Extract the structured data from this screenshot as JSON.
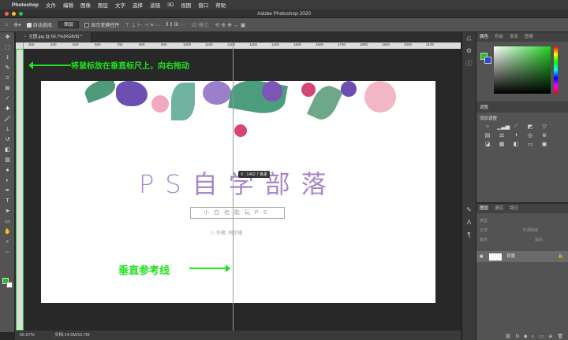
{
  "menubar": {
    "app": "Photoshop",
    "items": [
      "文件",
      "编辑",
      "图像",
      "图层",
      "文字",
      "选择",
      "滤镜",
      "3D",
      "视图",
      "窗口",
      "帮助"
    ]
  },
  "window": {
    "title": "Adobe Photoshop 2020"
  },
  "options": {
    "auto_select_label": "自动选择:",
    "auto_select_value": "图层",
    "transform_label": "显示变换控件",
    "mode_3d": "3D 模式:"
  },
  "document": {
    "tab_label": "主图.jpg @ 66.7%(RGB/8) *"
  },
  "ruler": {
    "ticks": [
      "300",
      "400",
      "500",
      "600",
      "700",
      "800",
      "900",
      "1000",
      "1100",
      "1200",
      "1300",
      "1400",
      "1500",
      "1600",
      "1700",
      "1800",
      "1900",
      "2000",
      "2100"
    ]
  },
  "canvas": {
    "title": "PS自学部落",
    "subtitle": "小白也能玩PS",
    "author": "作者: 阿尔塔",
    "tooltip": "X : 1462.7 像素"
  },
  "annotations": {
    "top": "将鼠标放在垂直标尺上，向右拖动",
    "bottom": "垂直参考线"
  },
  "status": {
    "zoom": "66.67%",
    "doc": "文档:14.5M/10.7M"
  },
  "panels": {
    "color_tabs": [
      "颜色",
      "色板",
      "渐变",
      "图案"
    ],
    "adjust_title": "调整",
    "adjust_add": "添加调整",
    "layers_tabs": [
      "图层",
      "通道",
      "路径"
    ],
    "layer_kind": "类型",
    "blend_mode": "正常",
    "opacity": "不透明度:",
    "lock": "锁定:",
    "fill": "填充:",
    "layer_name": "背景"
  },
  "colors": {
    "accent": "#1ee21e",
    "title_purple": "#a687c8",
    "foreground": "#22c322",
    "background_swatch": "#224bd6"
  }
}
